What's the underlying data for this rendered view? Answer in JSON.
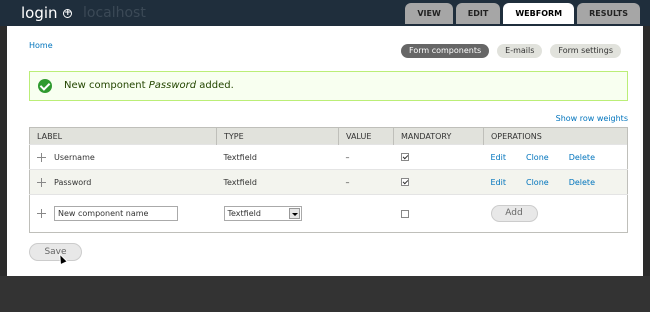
{
  "header": {
    "title": "login",
    "site_name": "localhost",
    "tabs": [
      {
        "label": "VIEW"
      },
      {
        "label": "EDIT"
      },
      {
        "label": "WEBFORM"
      },
      {
        "label": "RESULTS"
      }
    ]
  },
  "breadcrumb": "Home",
  "secondary_tabs": [
    {
      "label": "Form components"
    },
    {
      "label": "E-mails"
    },
    {
      "label": "Form settings"
    }
  ],
  "message": {
    "prefix": "New component",
    "component": "Password",
    "suffix": "added."
  },
  "row_weights_link": "Show row weights",
  "table": {
    "headers": [
      "LABEL",
      "TYPE",
      "VALUE",
      "MANDATORY",
      "OPERATIONS"
    ],
    "rows": [
      {
        "label": "Username",
        "type": "Textfield",
        "value": "–",
        "mandatory": true,
        "ops": [
          "Edit",
          "Clone",
          "Delete"
        ]
      },
      {
        "label": "Password",
        "type": "Textfield",
        "value": "–",
        "mandatory": true,
        "ops": [
          "Edit",
          "Clone",
          "Delete"
        ]
      }
    ],
    "new_component": {
      "name_value": "New component name",
      "type_value": "Textfield",
      "add_label": "Add"
    }
  },
  "save_label": "Save"
}
